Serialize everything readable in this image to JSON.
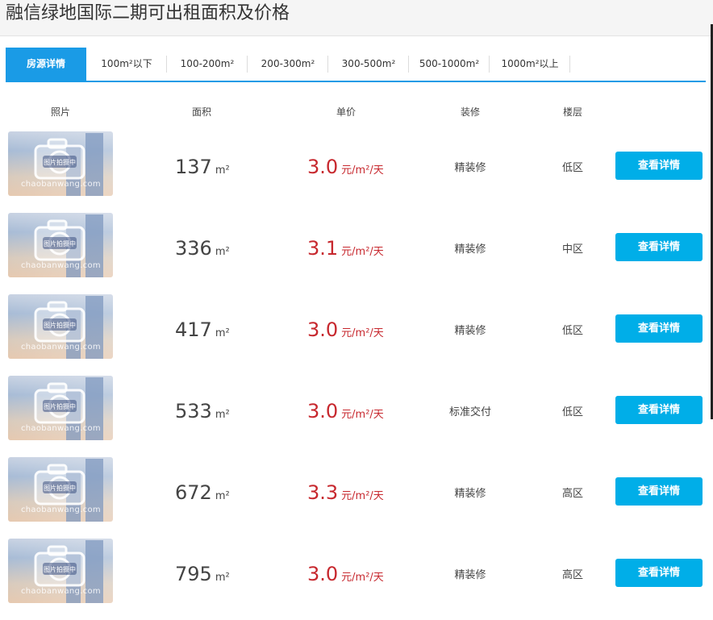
{
  "page": {
    "title": "融信绿地国际二期可出租面积及价格"
  },
  "tabs": [
    {
      "label": "房源详情",
      "active": true
    },
    {
      "label": "100m²以下"
    },
    {
      "label": "100-200m²"
    },
    {
      "label": "200-300m²"
    },
    {
      "label": "300-500m²"
    },
    {
      "label": "500-1000m²"
    },
    {
      "label": "1000m²以上"
    }
  ],
  "columns": {
    "photo": "照片",
    "area": "面积",
    "price": "单价",
    "decoration": "装修",
    "floor": "楼层"
  },
  "thumbnail": {
    "badge": "图片拍摄中",
    "watermark": "chaobanwang.com"
  },
  "units": {
    "area": "m²",
    "price": "元/m²/天"
  },
  "listings": [
    {
      "area": "137",
      "price": "3.0",
      "decoration": "精装修",
      "floor": "低区",
      "button": "查看详情"
    },
    {
      "area": "336",
      "price": "3.1",
      "decoration": "精装修",
      "floor": "中区",
      "button": "查看详情"
    },
    {
      "area": "417",
      "price": "3.0",
      "decoration": "精装修",
      "floor": "低区",
      "button": "查看详情"
    },
    {
      "area": "533",
      "price": "3.0",
      "decoration": "标准交付",
      "floor": "低区",
      "button": "查看详情"
    },
    {
      "area": "672",
      "price": "3.3",
      "decoration": "精装修",
      "floor": "高区",
      "button": "查看详情"
    },
    {
      "area": "795",
      "price": "3.0",
      "decoration": "精装修",
      "floor": "高区",
      "button": "查看详情"
    }
  ],
  "colors": {
    "accent": "#1a9be6",
    "button": "#00aee8",
    "price": "#c7282e"
  }
}
